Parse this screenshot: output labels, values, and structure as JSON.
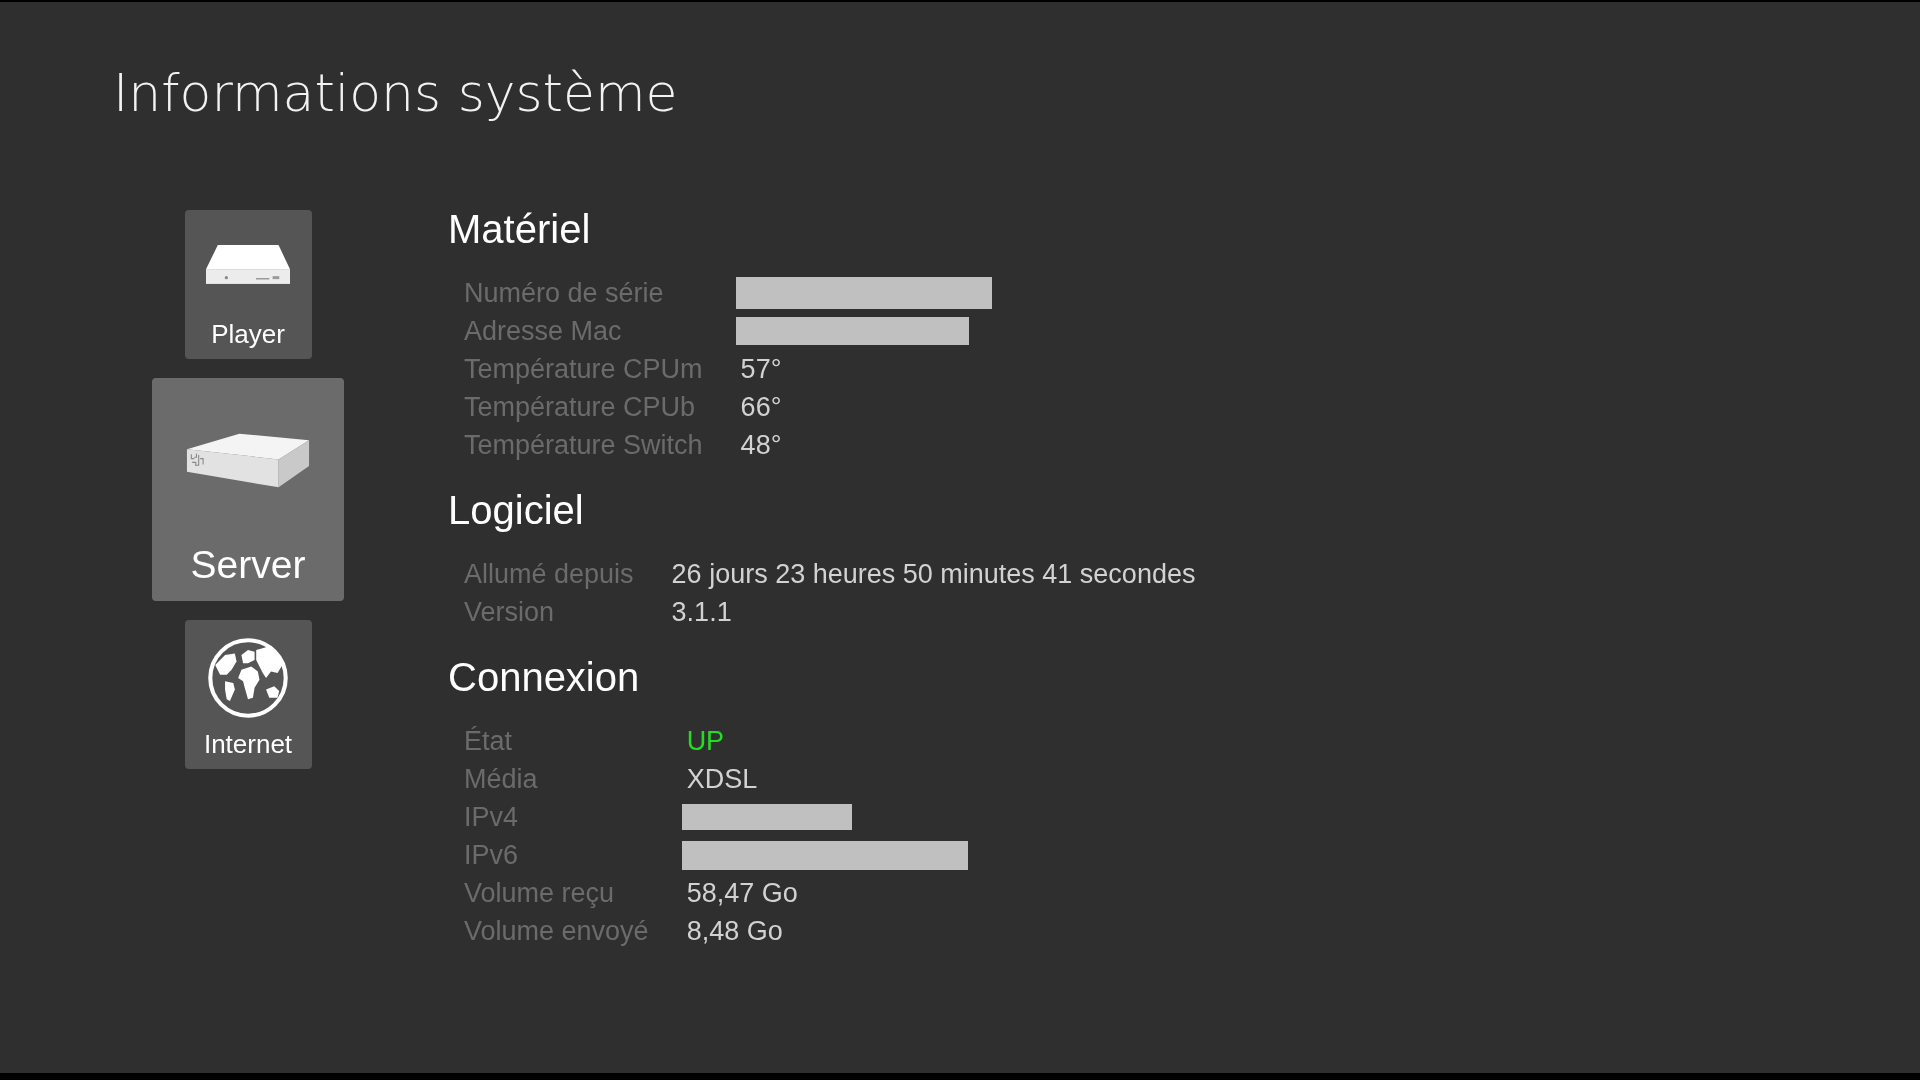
{
  "title": "Informations système",
  "sidebar": {
    "items": [
      {
        "kind": "player",
        "label": "Player",
        "selected": false
      },
      {
        "kind": "server",
        "label": "Server",
        "selected": true
      },
      {
        "kind": "internet",
        "label": "Internet",
        "selected": false
      }
    ]
  },
  "sections": [
    {
      "heading": "Matériel",
      "rows": [
        {
          "label": "Numéro de série",
          "kind": "redacted"
        },
        {
          "label": "Adresse Mac",
          "kind": "redacted"
        },
        {
          "label": "Température CPUm",
          "kind": "text",
          "value": "57°"
        },
        {
          "label": "Température CPUb",
          "kind": "text",
          "value": "66°"
        },
        {
          "label": "Température Switch",
          "kind": "text",
          "value": "48°"
        }
      ]
    },
    {
      "heading": "Logiciel",
      "rows": [
        {
          "label": "Allumé depuis",
          "kind": "text",
          "value": "26 jours 23 heures 50 minutes 41 secondes"
        },
        {
          "label": "Version",
          "kind": "text",
          "value": "3.1.1"
        }
      ]
    },
    {
      "heading": "Connexion",
      "rows": [
        {
          "label": "État",
          "kind": "text",
          "value": "UP",
          "color": "#22dd22"
        },
        {
          "label": "Média",
          "kind": "text",
          "value": "XDSL"
        },
        {
          "label": "IPv4",
          "kind": "redacted"
        },
        {
          "label": "IPv6",
          "kind": "redacted"
        },
        {
          "label": "Volume reçu",
          "kind": "text",
          "value": "58,47 Go"
        },
        {
          "label": "Volume envoyé",
          "kind": "text",
          "value": "8,48 Go"
        }
      ]
    }
  ]
}
